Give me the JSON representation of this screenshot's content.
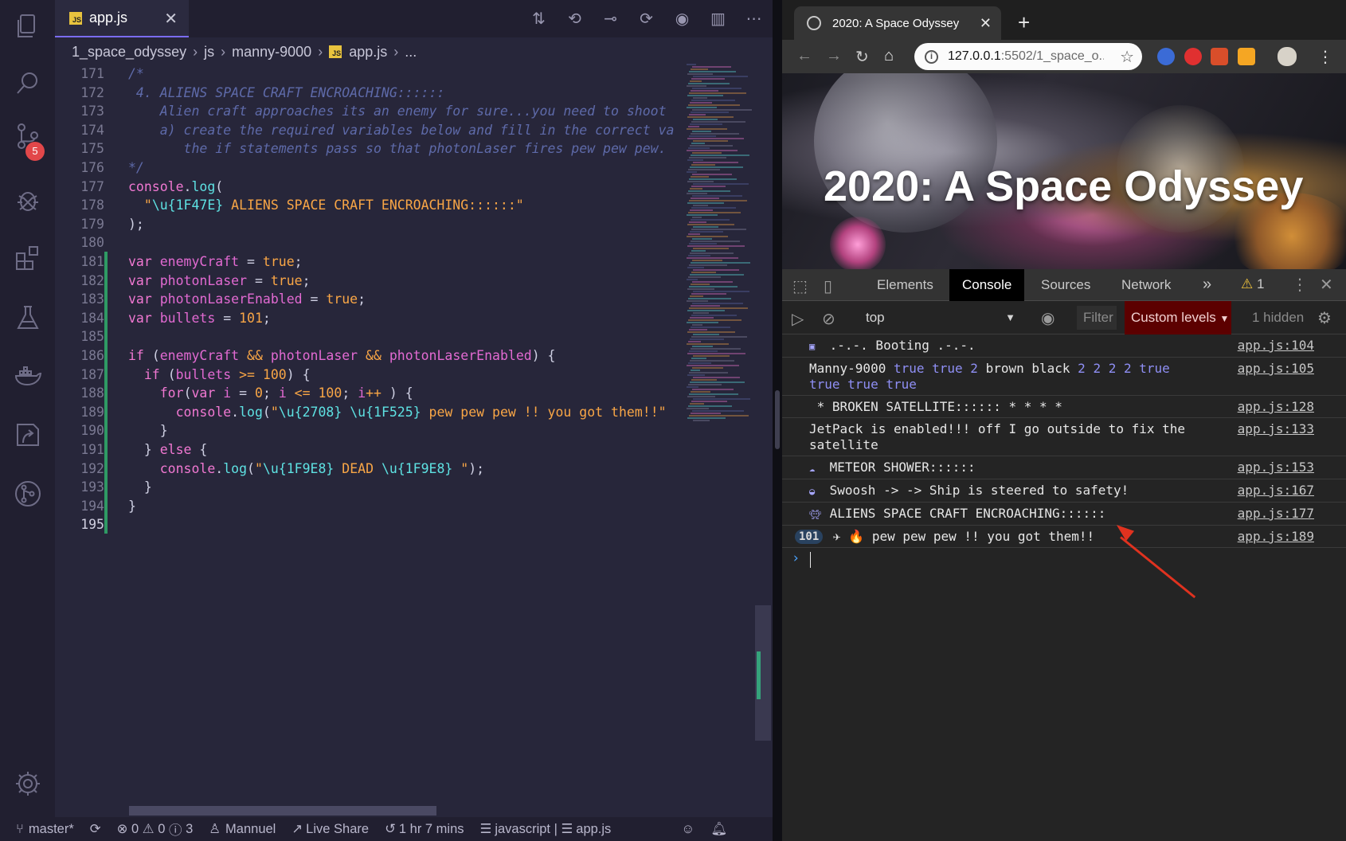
{
  "vscode": {
    "tab": {
      "label": "app.js",
      "badge": "JS"
    },
    "scm_badge": "5",
    "breadcrumb": [
      "1_space_odyssey",
      "js",
      "manny-9000",
      "app.js",
      "..."
    ],
    "status": {
      "branch": "master*",
      "errors": "0",
      "warnings": "0",
      "infos": "3",
      "user": "Mannuel",
      "live_share": "Live Share",
      "time": "1 hr 7 mins",
      "language": "javascript",
      "file": "app.js"
    },
    "lines": [
      {
        "n": "171",
        "t": [
          [
            "cm",
            "/*"
          ]
        ]
      },
      {
        "n": "172",
        "t": [
          [
            "cm",
            " 4. ALIENS SPACE CRAFT ENCROACHING::::::"
          ]
        ]
      },
      {
        "n": "173",
        "t": [
          [
            "cm",
            "    Alien craft approaches its an enemy for sure...you need to shoot"
          ]
        ]
      },
      {
        "n": "174",
        "t": [
          [
            "cm",
            "    a) create the required variables below and fill in the correct va"
          ]
        ]
      },
      {
        "n": "175",
        "t": [
          [
            "cm",
            "       the if statements pass so that photonLaser fires pew pew pew."
          ]
        ]
      },
      {
        "n": "176",
        "t": [
          [
            "cm",
            "*/"
          ]
        ]
      },
      {
        "n": "177",
        "t": [
          [
            "call",
            "console"
          ],
          [
            "p",
            "."
          ],
          [
            "fn",
            "log"
          ],
          [
            "p",
            "("
          ]
        ]
      },
      {
        "n": "178",
        "t": [
          [
            "p",
            "  "
          ],
          [
            "str",
            "\""
          ],
          [
            "esc",
            "\\u{1F47E}"
          ],
          [
            "str",
            " ALIENS SPACE CRAFT ENCROACHING::::::\""
          ]
        ]
      },
      {
        "n": "179",
        "t": [
          [
            "p",
            ");"
          ]
        ]
      },
      {
        "n": "180",
        "t": []
      },
      {
        "n": "181",
        "t": [
          [
            "kw",
            "var "
          ],
          [
            "var",
            "enemyCraft"
          ],
          [
            "p",
            " = "
          ],
          [
            "bool",
            "true"
          ],
          [
            "p",
            ";"
          ]
        ]
      },
      {
        "n": "182",
        "t": [
          [
            "kw",
            "var "
          ],
          [
            "var",
            "photonLaser"
          ],
          [
            "p",
            " = "
          ],
          [
            "bool",
            "true"
          ],
          [
            "p",
            ";"
          ]
        ]
      },
      {
        "n": "183",
        "t": [
          [
            "kw",
            "var "
          ],
          [
            "var",
            "photonLaserEnabled"
          ],
          [
            "p",
            " = "
          ],
          [
            "bool",
            "true"
          ],
          [
            "p",
            ";"
          ]
        ]
      },
      {
        "n": "184",
        "t": [
          [
            "kw",
            "var "
          ],
          [
            "var",
            "bullets"
          ],
          [
            "p",
            " = "
          ],
          [
            "num",
            "101"
          ],
          [
            "p",
            ";"
          ]
        ]
      },
      {
        "n": "185",
        "t": []
      },
      {
        "n": "186",
        "t": [
          [
            "kw",
            "if "
          ],
          [
            "p",
            "("
          ],
          [
            "var",
            "enemyCraft"
          ],
          [
            "op",
            " && "
          ],
          [
            "var",
            "photonLaser"
          ],
          [
            "op",
            " && "
          ],
          [
            "var",
            "photonLaserEnabled"
          ],
          [
            "p",
            ") {"
          ]
        ]
      },
      {
        "n": "187",
        "t": [
          [
            "p",
            "  "
          ],
          [
            "kw",
            "if "
          ],
          [
            "p",
            "("
          ],
          [
            "var",
            "bullets"
          ],
          [
            "op",
            " >= "
          ],
          [
            "num",
            "100"
          ],
          [
            "p",
            ") {"
          ]
        ]
      },
      {
        "n": "188",
        "t": [
          [
            "p",
            "    "
          ],
          [
            "kw",
            "for"
          ],
          [
            "p",
            "("
          ],
          [
            "kw",
            "var "
          ],
          [
            "var",
            "i"
          ],
          [
            "p",
            " = "
          ],
          [
            "num",
            "0"
          ],
          [
            "p",
            "; "
          ],
          [
            "var",
            "i"
          ],
          [
            "op",
            " <= "
          ],
          [
            "num",
            "100"
          ],
          [
            "p",
            "; "
          ],
          [
            "var",
            "i"
          ],
          [
            "op",
            "++"
          ],
          [
            "p",
            " ) {"
          ]
        ]
      },
      {
        "n": "189",
        "t": [
          [
            "p",
            "      "
          ],
          [
            "call",
            "console"
          ],
          [
            "p",
            "."
          ],
          [
            "fn",
            "log"
          ],
          [
            "p",
            "("
          ],
          [
            "str",
            "\""
          ],
          [
            "esc",
            "\\u{2708}"
          ],
          [
            "str",
            " "
          ],
          [
            "esc",
            "\\u{1F525}"
          ],
          [
            "str",
            " pew pew pew !! you got them!!\""
          ]
        ]
      },
      {
        "n": "190",
        "t": [
          [
            "p",
            "    }"
          ]
        ]
      },
      {
        "n": "191",
        "t": [
          [
            "p",
            "  } "
          ],
          [
            "kw",
            "else"
          ],
          [
            "p",
            " {"
          ]
        ]
      },
      {
        "n": "192",
        "t": [
          [
            "p",
            "    "
          ],
          [
            "call",
            "console"
          ],
          [
            "p",
            "."
          ],
          [
            "fn",
            "log"
          ],
          [
            "p",
            "("
          ],
          [
            "str",
            "\""
          ],
          [
            "esc",
            "\\u{1F9E8}"
          ],
          [
            "str",
            " DEAD "
          ],
          [
            "esc",
            "\\u{1F9E8}"
          ],
          [
            "str",
            " \""
          ],
          [
            "p",
            ");"
          ]
        ]
      },
      {
        "n": "193",
        "t": [
          [
            "p",
            "  }"
          ]
        ]
      },
      {
        "n": "194",
        "t": [
          [
            "p",
            "}"
          ]
        ]
      },
      {
        "n": "195",
        "t": []
      }
    ]
  },
  "chrome": {
    "tab_title": "2020: A Space Odyssey",
    "url_host": "127.0.0.1",
    "url_rest": ":5502/1_space_o...",
    "hero_title": "2020: A Space Odyssey",
    "devtools": {
      "tabs": [
        "Elements",
        "Console",
        "Sources",
        "Network"
      ],
      "warnings": "1",
      "context": "top",
      "filter_placeholder": "Filter",
      "levels": "Custom levels",
      "hidden": "1 hidden"
    },
    "console": [
      {
        "icon": "robot",
        "text": " .-.-. Booting .-.-.",
        "src": "app.js:104"
      },
      {
        "icon": "",
        "text": "Manny-9000 ",
        "blue": "true true 2",
        "text2": " brown black ",
        "blue2": "2 2 2 2 true true true true",
        "src": "app.js:105"
      },
      {
        "icon": "",
        "text": " * BROKEN SATELLITE:::::: * * * *",
        "src": "app.js:128"
      },
      {
        "icon": "",
        "text": "JetPack is enabled!!! off I go outside to fix the satellite",
        "src": "app.js:133"
      },
      {
        "icon": "cloud",
        "text": " METEOR SHOWER::::::",
        "src": "app.js:153"
      },
      {
        "icon": "saucer",
        "text": " Swoosh -> -> Ship is steered to safety!",
        "src": "app.js:167"
      },
      {
        "icon": "alien",
        "text": " ALIENS SPACE CRAFT ENCROACHING::::::",
        "src": "app.js:177"
      },
      {
        "icon": "",
        "repeat": "101",
        "text": "✈ 🔥 pew pew pew !! you got them!!",
        "src": "app.js:189"
      }
    ]
  }
}
